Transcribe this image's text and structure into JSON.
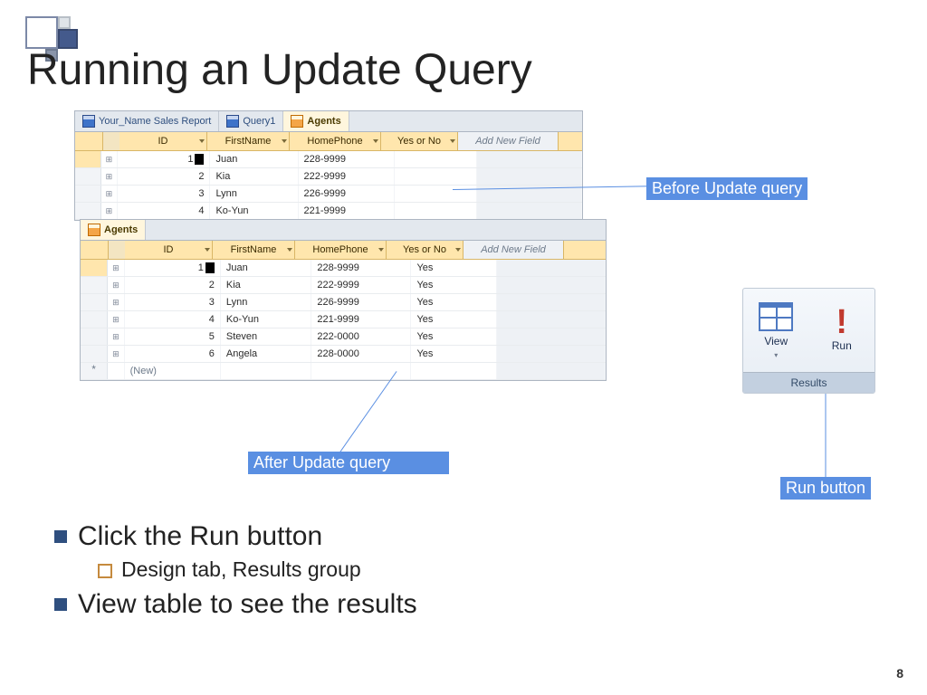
{
  "slide": {
    "title": "Running an Update Query",
    "page_number": "8"
  },
  "callouts": {
    "before": "Before Update query",
    "after": "After Update query",
    "run": "Run button"
  },
  "tabs": {
    "report": "Your_Name Sales Report",
    "query": "Query1",
    "agents": "Agents"
  },
  "columns": {
    "id": "ID",
    "first": "FirstName",
    "phone": "HomePhone",
    "yn": "Yes or No",
    "add": "Add New Field"
  },
  "before_rows": [
    {
      "id": "1",
      "first": "Juan",
      "phone": "228-9999",
      "yn": ""
    },
    {
      "id": "2",
      "first": "Kia",
      "phone": "222-9999",
      "yn": ""
    },
    {
      "id": "3",
      "first": "Lynn",
      "phone": "226-9999",
      "yn": ""
    },
    {
      "id": "4",
      "first": "Ko-Yun",
      "phone": "221-9999",
      "yn": ""
    }
  ],
  "after_rows": [
    {
      "id": "1",
      "first": "Juan",
      "phone": "228-9999",
      "yn": "Yes"
    },
    {
      "id": "2",
      "first": "Kia",
      "phone": "222-9999",
      "yn": "Yes"
    },
    {
      "id": "3",
      "first": "Lynn",
      "phone": "226-9999",
      "yn": "Yes"
    },
    {
      "id": "4",
      "first": "Ko-Yun",
      "phone": "221-9999",
      "yn": "Yes"
    },
    {
      "id": "5",
      "first": "Steven",
      "phone": "222-0000",
      "yn": "Yes"
    },
    {
      "id": "6",
      "first": "Angela",
      "phone": "228-0000",
      "yn": "Yes"
    }
  ],
  "new_row_label": "(New)",
  "ribbon": {
    "view": "View",
    "run": "Run",
    "group": "Results"
  },
  "bullets": {
    "b1": "Click the Run button",
    "b1a": "Design tab, Results group",
    "b2": "View table to see the results"
  }
}
